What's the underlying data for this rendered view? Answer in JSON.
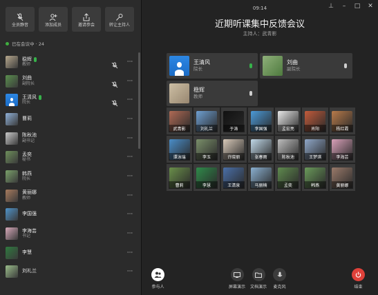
{
  "toolbar": [
    {
      "label": "全员静音",
      "icon": "mute-mic-icon"
    },
    {
      "label": "添加成员",
      "icon": "add-user-icon"
    },
    {
      "label": "邀请参会",
      "icon": "share-icon"
    },
    {
      "label": "转让主持人",
      "icon": "transfer-icon"
    }
  ],
  "section_label": "已在会议中 · 24",
  "members": [
    {
      "name": "稳辉",
      "role": "教师",
      "mic": true,
      "muted_video": true,
      "avatar": "#b7a88e"
    },
    {
      "name": "刘曲",
      "role": "副院长",
      "mic": false,
      "muted_video": true,
      "avatar": "#5a8f4e"
    },
    {
      "name": "王清风",
      "role": "院长",
      "mic": true,
      "muted_video": true,
      "avatar": "blue"
    },
    {
      "name": "曹莉",
      "role": "",
      "mic": false,
      "muted_video": false,
      "avatar": "#8fb0d8"
    },
    {
      "name": "陈秋池",
      "role": "副书记",
      "mic": false,
      "muted_video": false,
      "avatar": "#c9c9c9"
    },
    {
      "name": "孟奕",
      "role": "秘书",
      "mic": false,
      "muted_video": false,
      "avatar": "#6e8f5b"
    },
    {
      "name": "韩燕",
      "role": "院长",
      "mic": false,
      "muted_video": false,
      "avatar": "#7aa06a"
    },
    {
      "name": "黄丽娜",
      "role": "教师",
      "mic": false,
      "muted_video": false,
      "avatar": "#a77b5e"
    },
    {
      "name": "李国强",
      "role": "",
      "mic": false,
      "muted_video": false,
      "avatar": "#4f93c9"
    },
    {
      "name": "李海芸",
      "role": "书记",
      "mic": false,
      "muted_video": false,
      "avatar": "#d7a8b9"
    },
    {
      "name": "李慧",
      "role": "",
      "mic": false,
      "muted_video": false,
      "avatar": "#2f7a3f"
    },
    {
      "name": "刘礼兰",
      "role": "",
      "mic": false,
      "muted_video": false,
      "avatar": "#9bbd8b"
    }
  ],
  "header": {
    "time": "09:14",
    "title": "近期听课集中反馈会议",
    "host": "主持人：武青影"
  },
  "speakers": [
    {
      "name": "王清风",
      "role": "院长",
      "mic_on": true,
      "avatar": "blue"
    },
    {
      "name": "刘曲",
      "role": "副院长",
      "mic_on": false,
      "avatar": "#5a8f4e"
    },
    {
      "name": "稳辉",
      "role": "教师",
      "mic_on": false,
      "avatar": "#b7a88e"
    }
  ],
  "grid": [
    {
      "name": "武青影",
      "color": "#b06a55"
    },
    {
      "name": "刘礼兰",
      "color": "#6e9fd1"
    },
    {
      "name": "于涛",
      "color": "#111111"
    },
    {
      "name": "李国强",
      "color": "#4b9ad8"
    },
    {
      "name": "孟宏亮",
      "color": "#e8e8e8"
    },
    {
      "name": "肖阳",
      "color": "#c25b3b"
    },
    {
      "name": "杨红霞",
      "color": "#b87a4a"
    },
    {
      "name": "谭泳瑞",
      "color": "#4a8dc8"
    },
    {
      "name": "李玉",
      "color": "#7a8f6a"
    },
    {
      "name": "许晓丽",
      "color": "#d7c8b8"
    },
    {
      "name": "张春雨",
      "color": "#c0d8e8"
    },
    {
      "name": "陈秋池",
      "color": "#bdbdbd"
    },
    {
      "name": "王梦琪",
      "color": "#8fa7c8"
    },
    {
      "name": "李海芸",
      "color": "#d8a0b8"
    },
    {
      "name": "曹莉",
      "color": "#6a8f4a"
    },
    {
      "name": "李慧",
      "color": "#2f8a4a"
    },
    {
      "name": "王清泉",
      "color": "#4a6fa8"
    },
    {
      "name": "马丽楠",
      "color": "#8ab0d0"
    },
    {
      "name": "孟奕",
      "color": "#5f8a4e"
    },
    {
      "name": "韩燕",
      "color": "#6a9a5a"
    },
    {
      "name": "黄丽娜",
      "color": "#9a7a6a"
    }
  ],
  "bottom": {
    "participants": "参与人",
    "screen_share": "屏幕演示",
    "doc_share": "文档演示",
    "microphone": "麦克风",
    "end": "结束"
  }
}
